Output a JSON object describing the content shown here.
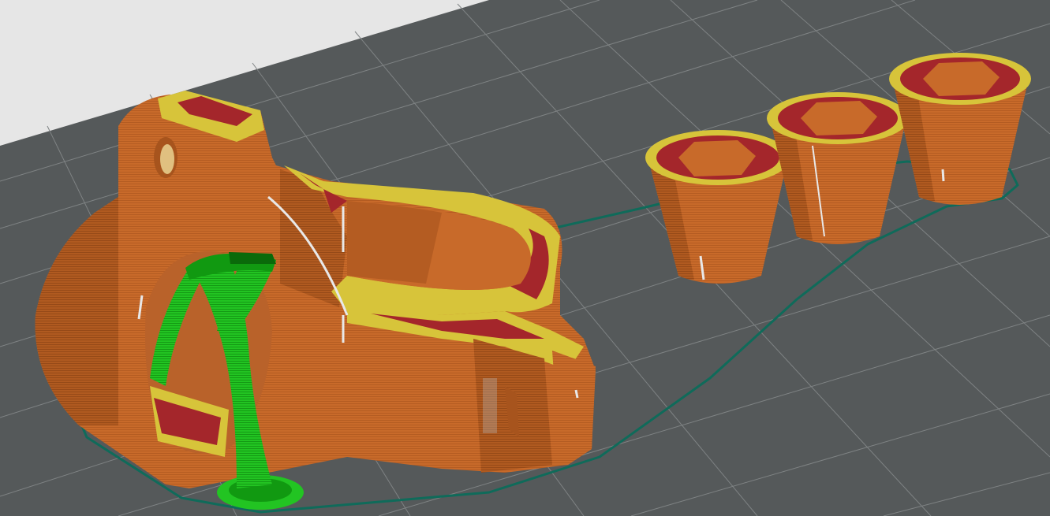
{
  "scene": {
    "view": "3d-slice-preview",
    "colors": {
      "background": "#e6e6e6",
      "bed": "#55595a",
      "bed_grid": "#8a8e8f",
      "perimeter": "#c86a2a",
      "perimeter_dark": "#a7541d",
      "infill": "#a4262b",
      "internal_perimeter": "#d7c43a",
      "support": "#22cc22",
      "support_dark": "#119911",
      "skirt": "#0f6b5a",
      "seam": "#e8e8e8"
    },
    "objects": [
      {
        "name": "clamp-bracket",
        "color_role": "perimeter"
      },
      {
        "name": "cup-1",
        "color_role": "perimeter"
      },
      {
        "name": "cup-2",
        "color_role": "perimeter"
      },
      {
        "name": "cup-3",
        "color_role": "perimeter"
      },
      {
        "name": "tree-support",
        "color_role": "support"
      },
      {
        "name": "skirt-outline",
        "color_role": "skirt"
      }
    ]
  }
}
